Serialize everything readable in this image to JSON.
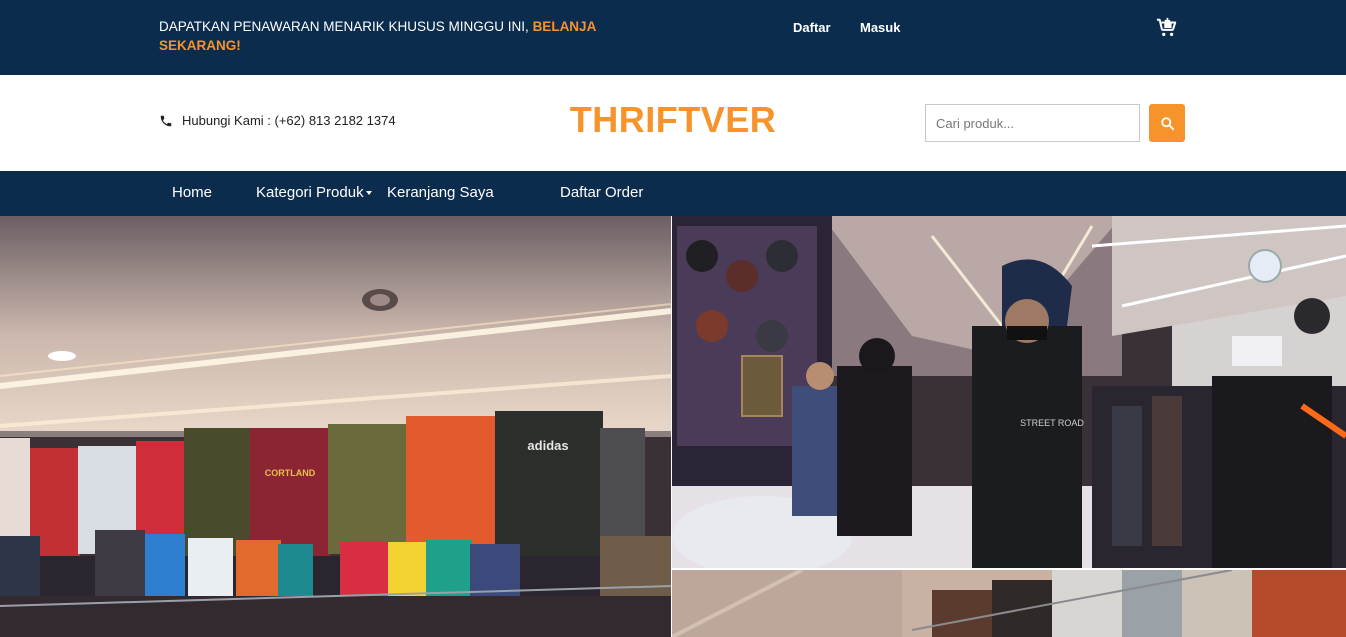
{
  "topbar": {
    "promo_text": "DAPATKAN PENAWARAN MENARIK KHUSUS MINGGU INI,",
    "promo_cta": "BELANJA SEKARANG!",
    "links": {
      "register": "Daftar",
      "login": "Masuk"
    },
    "cart_icon": "cart-plus-icon"
  },
  "header": {
    "contact_label": "Hubungi Kami : (+62) 813 2182 1374",
    "contact_icon": "phone-icon",
    "brand": "THRIFTVER",
    "search": {
      "placeholder": "Cari produk...",
      "value": "",
      "icon": "search-icon"
    }
  },
  "nav": {
    "items": [
      {
        "label": "Home"
      },
      {
        "label": "Kategori Produk",
        "has_dropdown": true
      },
      {
        "label": "Keranjang Saya"
      },
      {
        "label": "Daftar Order"
      }
    ]
  },
  "colors": {
    "navy": "#0b2c4d",
    "accent": "#f7932b"
  }
}
